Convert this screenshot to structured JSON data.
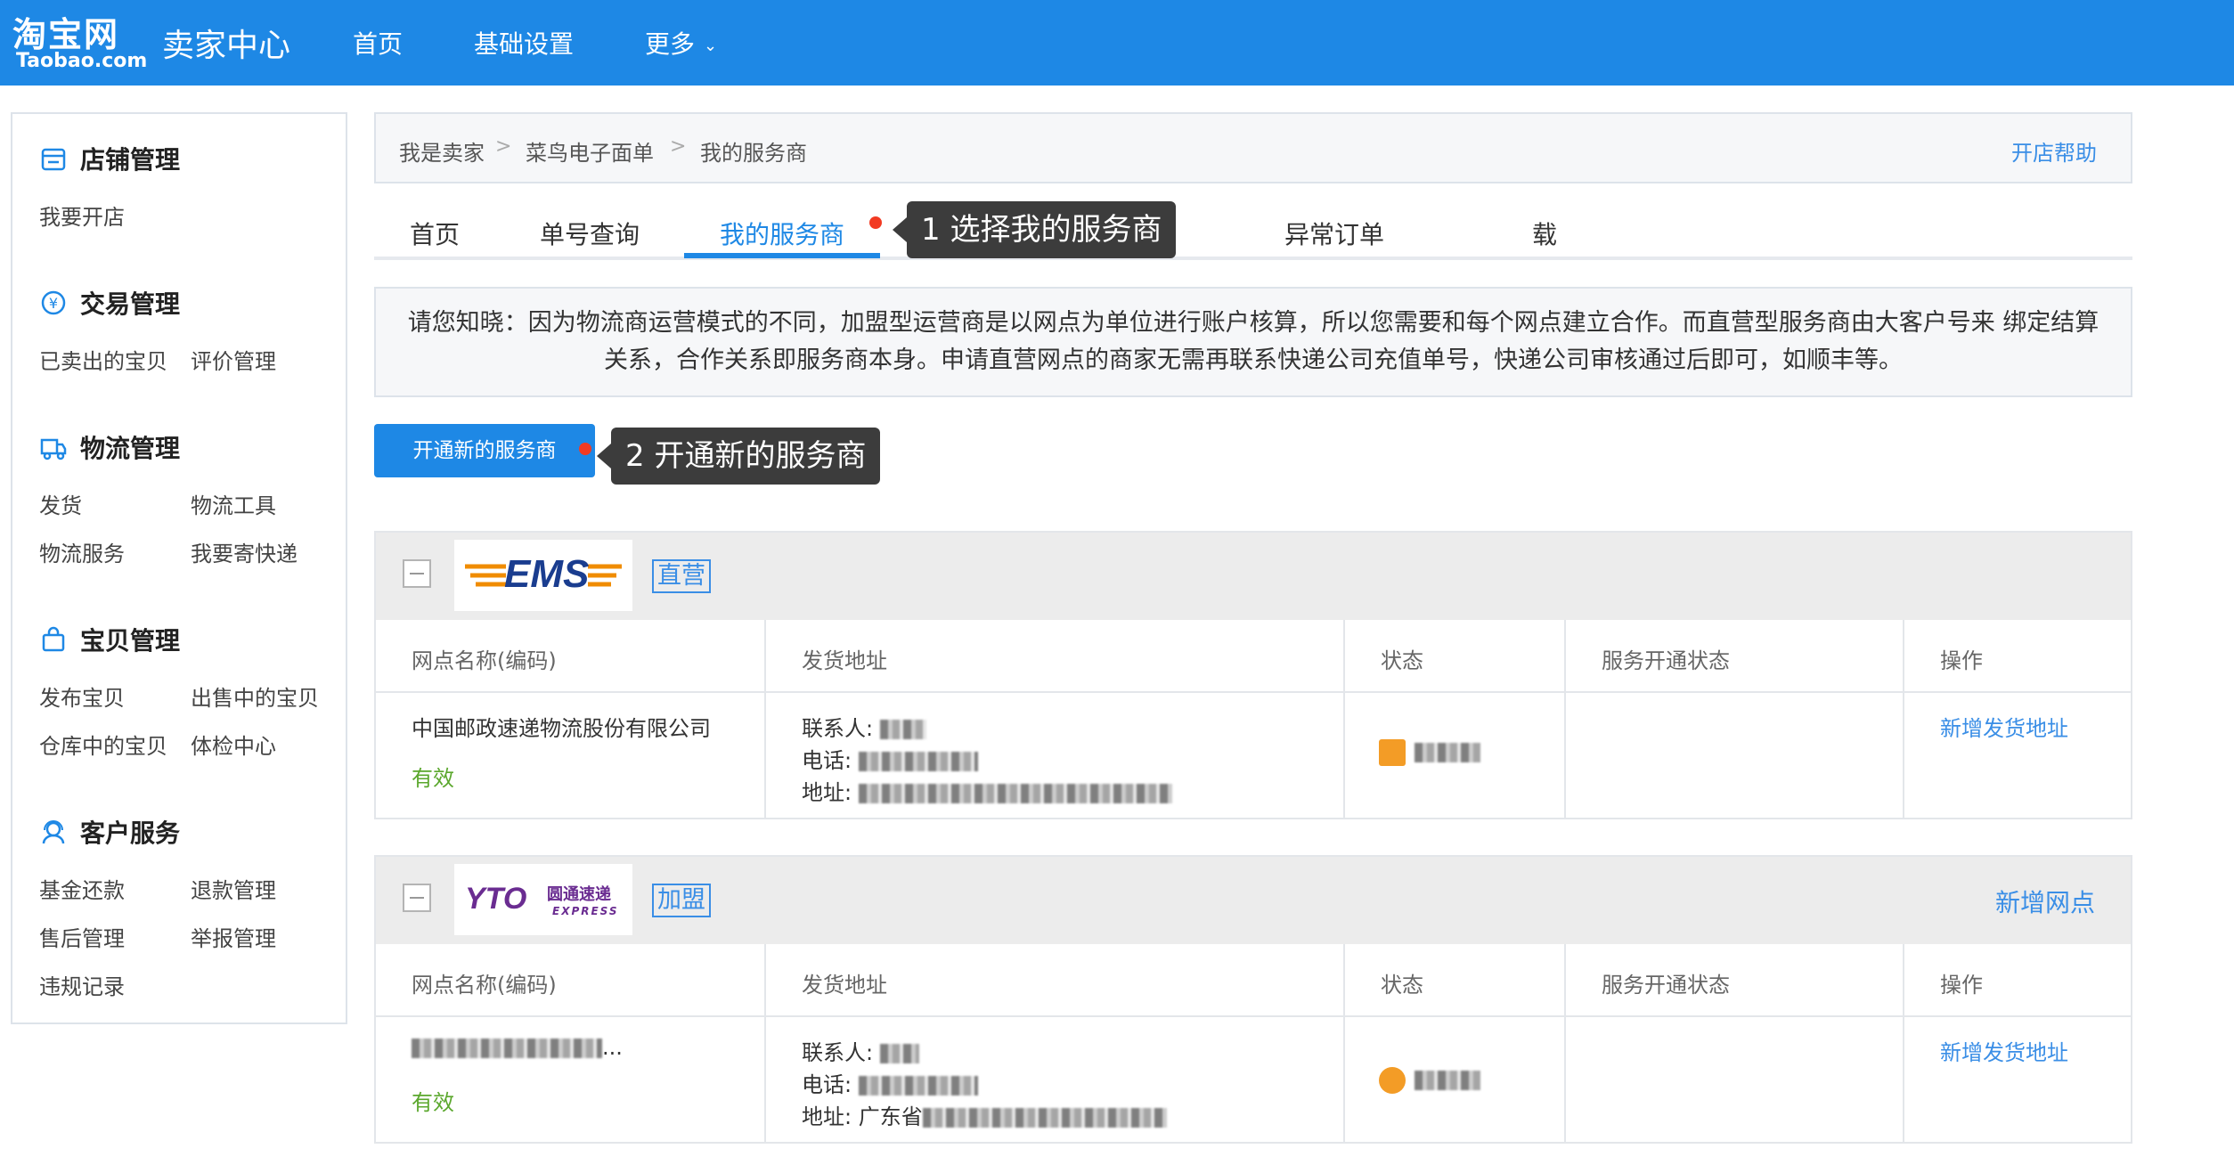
{
  "header": {
    "logo_main": "淘宝网",
    "logo_sub": "Taobao.com",
    "center_title": "卖家中心",
    "nav": [
      "首页",
      "基础设置",
      "更多"
    ]
  },
  "sidebar": {
    "sections": [
      {
        "title": "店铺管理",
        "icon": "shop-icon",
        "links": [
          "我要开店"
        ]
      },
      {
        "title": "交易管理",
        "icon": "currency-icon",
        "links": [
          "已卖出的宝贝",
          "评价管理"
        ]
      },
      {
        "title": "物流管理",
        "icon": "truck-icon",
        "links": [
          "发货",
          "物流工具",
          "物流服务",
          "我要寄快递"
        ]
      },
      {
        "title": "宝贝管理",
        "icon": "bag-icon",
        "links": [
          "发布宝贝",
          "出售中的宝贝",
          "仓库中的宝贝",
          "体检中心"
        ]
      },
      {
        "title": "客户服务",
        "icon": "customer-service-icon",
        "links": [
          "基金还款",
          "退款管理",
          "售后管理",
          "举报管理",
          "违规记录"
        ]
      }
    ]
  },
  "breadcrumb": {
    "items": [
      "我是卖家",
      "菜鸟电子面单",
      "我的服务商"
    ],
    "separator": ">",
    "help": "开店帮助"
  },
  "tabs": {
    "items": [
      "首页",
      "单号查询",
      "我的服务商",
      "载",
      "异常订单"
    ],
    "active_index": 2
  },
  "annotations": {
    "tip1": "1 选择我的服务商",
    "tip2": "2 开通新的服务商"
  },
  "notice": "请您知晓：因为物流商运营模式的不同，加盟型运营商是以网点为单位进行账户核算，所以您需要和每个网点建立合作。而直营型服务商由大客户号来 绑定结算关系，合作关系即服务商本身。申请直营网点的商家无需再联系快递公司充值单号，快递公司审核通过后即可，如顺丰等。",
  "open_button": "开通新的服务商",
  "columns": [
    "网点名称(编码)",
    "发货地址",
    "状态",
    "服务开通状态",
    "操作"
  ],
  "providers": [
    {
      "logo_text": "EMS",
      "type": "直营",
      "add_point": "",
      "name": "中国邮政速递物流股份有限公司",
      "validity": "有效",
      "contact_label": "联系人:",
      "phone_label": "电话:",
      "address_label": "地址:",
      "action": "新增发货地址",
      "brand_color": "#f08c00"
    },
    {
      "logo_text": "YTO",
      "logo_cn": "圆通速递",
      "logo_en": "EXPRESS",
      "type": "加盟",
      "add_point": "新增网点",
      "name_suffix": "...",
      "validity": "有效",
      "contact_label": "联系人:",
      "phone_label": "电话:",
      "address_label": "地址:",
      "address_prefix": "广东省",
      "action": "新增发货地址",
      "brand_color": "#6a2c91"
    }
  ]
}
